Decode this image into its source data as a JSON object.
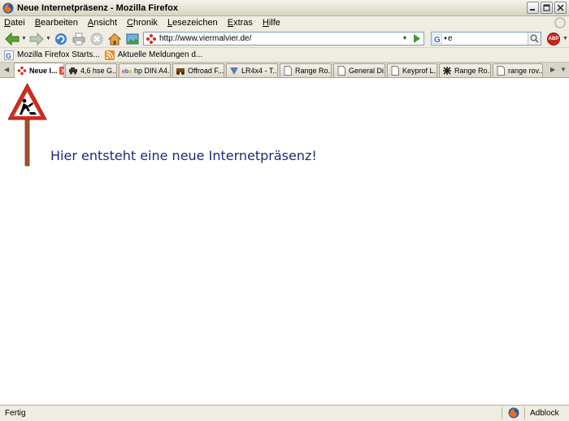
{
  "window": {
    "title": "Neue Internetpräsenz - Mozilla Firefox",
    "minimize_icon": "minimize-icon",
    "maximize_icon": "maximize-icon",
    "close_icon": "close-icon"
  },
  "menu": {
    "items": [
      {
        "accel": "D",
        "rest": "atei"
      },
      {
        "accel": "B",
        "rest": "earbeiten"
      },
      {
        "accel": "A",
        "rest": "nsicht"
      },
      {
        "accel": "C",
        "rest": "hronik"
      },
      {
        "accel": "L",
        "rest": "esezeichen"
      },
      {
        "accel": "E",
        "rest": "xtras"
      },
      {
        "accel": "H",
        "rest": "ilfe"
      }
    ]
  },
  "navigation": {
    "url": "http://www.viermalvier.de/",
    "search_value": "e"
  },
  "bookmarks": {
    "items": [
      {
        "label": "Mozilla Firefox Starts..."
      },
      {
        "label": "Aktuelle Meldungen d..."
      }
    ]
  },
  "tabs": [
    {
      "label": "Neue I...",
      "active": true
    },
    {
      "label": "4,6 hse G..."
    },
    {
      "label": "hp DIN A4..."
    },
    {
      "label": "Offroad F..."
    },
    {
      "label": "LR4x4 - T..."
    },
    {
      "label": "Range Ro..."
    },
    {
      "label": "General Di..."
    },
    {
      "label": "Keyprof L..."
    },
    {
      "label": "Range Ro..."
    },
    {
      "label": "range rov..."
    }
  ],
  "content": {
    "headline": "Hier entsteht eine neue Internetpräsenz!"
  },
  "status": {
    "text": "Fertig",
    "adblock": "Adblock",
    "abp_label": "ABP"
  },
  "colors": {
    "headline": "#1c2a78",
    "sign_red": "#d52b1e",
    "post_brown": "#a0522d"
  }
}
